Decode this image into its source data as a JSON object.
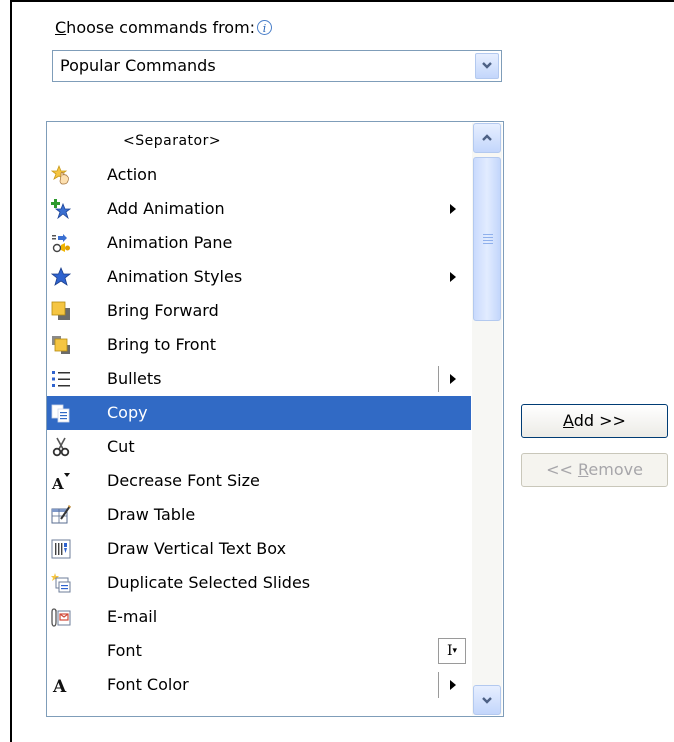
{
  "chooser": {
    "label_prefix": "",
    "label_accel": "C",
    "label_rest": "hoose commands from:",
    "info_glyph": "i",
    "selected_value": "Popular Commands"
  },
  "commands": [
    {
      "label": "<Separator>"
    },
    {
      "label": "Action"
    },
    {
      "label": "Add Animation"
    },
    {
      "label": "Animation Pane"
    },
    {
      "label": "Animation Styles"
    },
    {
      "label": "Bring Forward"
    },
    {
      "label": "Bring to Front"
    },
    {
      "label": "Bullets"
    },
    {
      "label": "Copy"
    },
    {
      "label": "Cut"
    },
    {
      "label": "Decrease Font Size"
    },
    {
      "label": "Draw Table"
    },
    {
      "label": "Draw Vertical Text Box"
    },
    {
      "label": "Duplicate Selected Slides"
    },
    {
      "label": "E-mail"
    },
    {
      "label": "Font"
    },
    {
      "label": "Font Color"
    }
  ],
  "selected_command": "Copy",
  "buttons": {
    "add_accel": "A",
    "add_rest": "dd >>",
    "remove_prefix": "<< ",
    "remove_accel": "R",
    "remove_rest": "emove"
  },
  "fontsize_glyph": "A",
  "fontcolor_glyph": "A",
  "font_ibeam_glyph": "I",
  "colors": {
    "selection": "#316ac5",
    "scroll_button": "#c3d6fb",
    "arrow_glyph": "#4d6185",
    "disabled_text": "#a7a6aa"
  }
}
